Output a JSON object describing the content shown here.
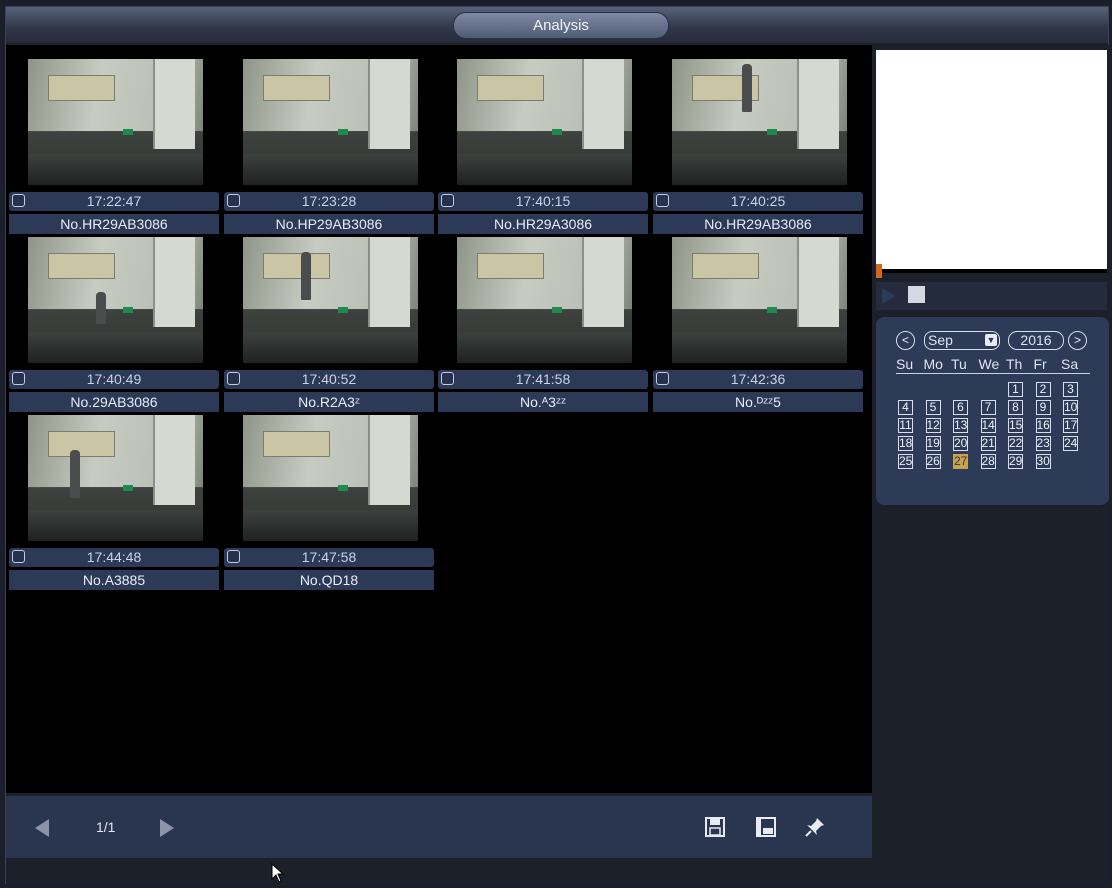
{
  "window": {
    "title": "Analysis"
  },
  "results": [
    {
      "time": "17:22:47",
      "plate": "No.HR29AB3086",
      "person": "none"
    },
    {
      "time": "17:23:28",
      "plate": "No.HP29AB3086",
      "person": "none"
    },
    {
      "time": "17:40:15",
      "plate": "No.HR29A3086",
      "person": "none"
    },
    {
      "time": "17:40:25",
      "plate": "No.HR29AB3086",
      "person": "standing-right"
    },
    {
      "time": "17:40:49",
      "plate": "No.29AB3086",
      "person": "crouching-left"
    },
    {
      "time": "17:40:52",
      "plate": "No.R2A3ᶻ",
      "person": "standing-center"
    },
    {
      "time": "17:41:58",
      "plate": "No.ᴬ3ᶻᶻ",
      "person": "none"
    },
    {
      "time": "17:42:36",
      "plate": "No.ᴰᶻᶻ5",
      "person": "none"
    },
    {
      "time": "17:44:48",
      "plate": "No.A3885",
      "person": "walking-left"
    },
    {
      "time": "17:47:58",
      "plate": "No.QD18",
      "person": "none"
    }
  ],
  "pagination": {
    "page": "1/1"
  },
  "calendar": {
    "month": "Sep",
    "year": "2016",
    "weekdays": [
      "Su",
      "Mo",
      "Tu",
      "We",
      "Th",
      "Fr",
      "Sa"
    ],
    "first_weekday_index": 4,
    "days_in_month": 30,
    "selected_day": 27,
    "days": [
      "1",
      "2",
      "3",
      "4",
      "5",
      "6",
      "7",
      "8",
      "9",
      "10",
      "11",
      "12",
      "13",
      "14",
      "15",
      "16",
      "17",
      "18",
      "19",
      "20",
      "21",
      "22",
      "23",
      "24",
      "25",
      "26",
      "27",
      "28",
      "29",
      "30"
    ]
  },
  "icons": {
    "prev": "chevron-left-icon",
    "next": "chevron-right-icon",
    "save": "save-icon",
    "backup": "film-backup-icon",
    "pin": "pin-icon",
    "play": "play-icon",
    "stop": "stop-icon",
    "calendar_prev": "<",
    "calendar_next": ">"
  },
  "colors": {
    "accent": "#2c3957",
    "today": "#c9a24a",
    "progress_handle": "#d06a1a"
  }
}
